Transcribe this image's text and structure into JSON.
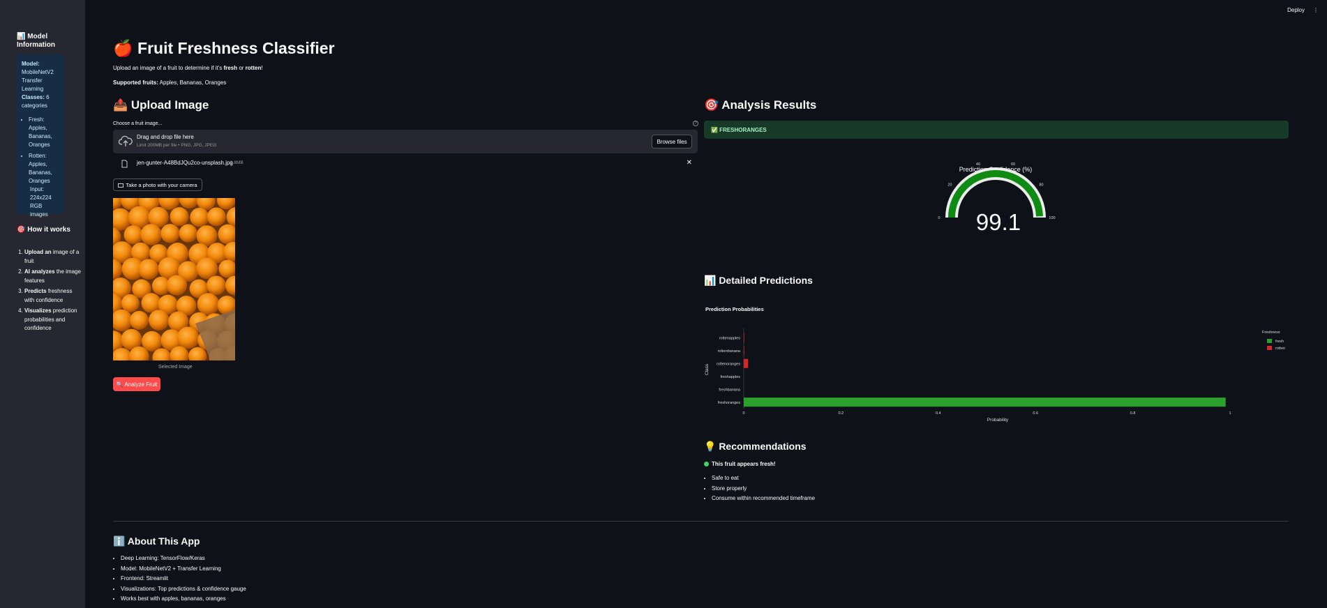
{
  "topbar": {
    "deploy": "Deploy",
    "menu": "⋮"
  },
  "sidebar": {
    "model_title": "📊 Model Information",
    "info": {
      "model_label": "Model:",
      "model_value": "MobileNetV2 Transfer Learning",
      "classes_label": "Classes:",
      "classes_value": "6 categories",
      "fresh_label": "Fresh:",
      "fresh_value": "Apples, Bananas, Oranges",
      "rotten_label": "Rotten:",
      "rotten_value": "Apples, Bananas, Oranges",
      "input_text": "Input: 224x224 RGB images"
    },
    "how_title": "🎯 How it works",
    "steps": [
      {
        "bold": "Upload an",
        "rest": "image of a fruit"
      },
      {
        "bold": "AI analyzes",
        "rest": "the image features"
      },
      {
        "bold": "Predicts",
        "rest": "freshness with confidence"
      },
      {
        "bold": "Visualizes",
        "rest": "prediction probabilities and confidence"
      }
    ]
  },
  "header": {
    "title": "🍎 Fruit Freshness Classifier",
    "intro_prefix": "Upload an image of a fruit to determine if it's",
    "intro_fresh": "fresh",
    "intro_or": "or",
    "intro_rotten": "rotten",
    "intro_end": "!",
    "supported_label": "Supported fruits:",
    "supported_value": "Apples, Bananas, Oranges"
  },
  "upload": {
    "heading": "📤 Upload Image",
    "choose_label": "Choose a fruit image...",
    "help_icon": "?",
    "drag_text": "Drag and drop file here",
    "limit_text": "Limit 200MB per file • PNG, JPG, JPEG",
    "browse": "Browse files",
    "file_name": "jen-gunter-A48BdJQu2co-unsplash.jpg",
    "file_size": "1.8MB",
    "remove": "✕",
    "camera_btn": "Take a photo with your camera",
    "caption": "Selected Image",
    "analyze_btn": "🔍 Analyze Fruit"
  },
  "results": {
    "heading": "🎯 Analysis Results",
    "success": "✅ FRESHORANGES",
    "gauge": {
      "title": "Prediction Confidence (%)",
      "value": "99.1",
      "fraction": 0.991,
      "ticks": [
        "0",
        "20",
        "40",
        "60",
        "80",
        "100"
      ],
      "color": "#0f8a13"
    }
  },
  "detailed": {
    "heading": "📊 Detailed Predictions"
  },
  "chart_data": {
    "type": "bar",
    "orientation": "horizontal",
    "title": "Prediction Probabilities",
    "xlabel": "Probability",
    "ylabel": "Class",
    "categories": [
      "rottenapples",
      "rottenbanana",
      "rottenoranges",
      "freshapples",
      "freshbanana",
      "freshoranges"
    ],
    "values": [
      0.001,
      0.001,
      0.009,
      0.0,
      0.0,
      0.991
    ],
    "groups": [
      "rotten",
      "rotten",
      "rotten",
      "fresh",
      "fresh",
      "fresh"
    ],
    "colors": {
      "fresh": "#2ca02c",
      "rotten": "#d62728"
    },
    "xticks": [
      "0",
      "0.2",
      "0.4",
      "0.6",
      "0.8",
      "1"
    ],
    "xlim": [
      0,
      1
    ],
    "legend_title": "Freshness",
    "legend": [
      "fresh",
      "rotten"
    ],
    "legend_position": "right"
  },
  "recommendations": {
    "heading": "💡 Recommendations",
    "status": "This fruit appears fresh!",
    "items": [
      "Safe to eat",
      "Store properly",
      "Consume within recommended timeframe"
    ]
  },
  "about": {
    "heading": "ℹ️ About This App",
    "items": [
      "Deep Learning: TensorFlow/Keras",
      "Model: MobileNetV2 + Transfer Learning",
      "Frontend: Streamlit",
      "Visualizations: Top predictions & confidence gauge",
      "Works best with apples, bananas, oranges"
    ]
  }
}
